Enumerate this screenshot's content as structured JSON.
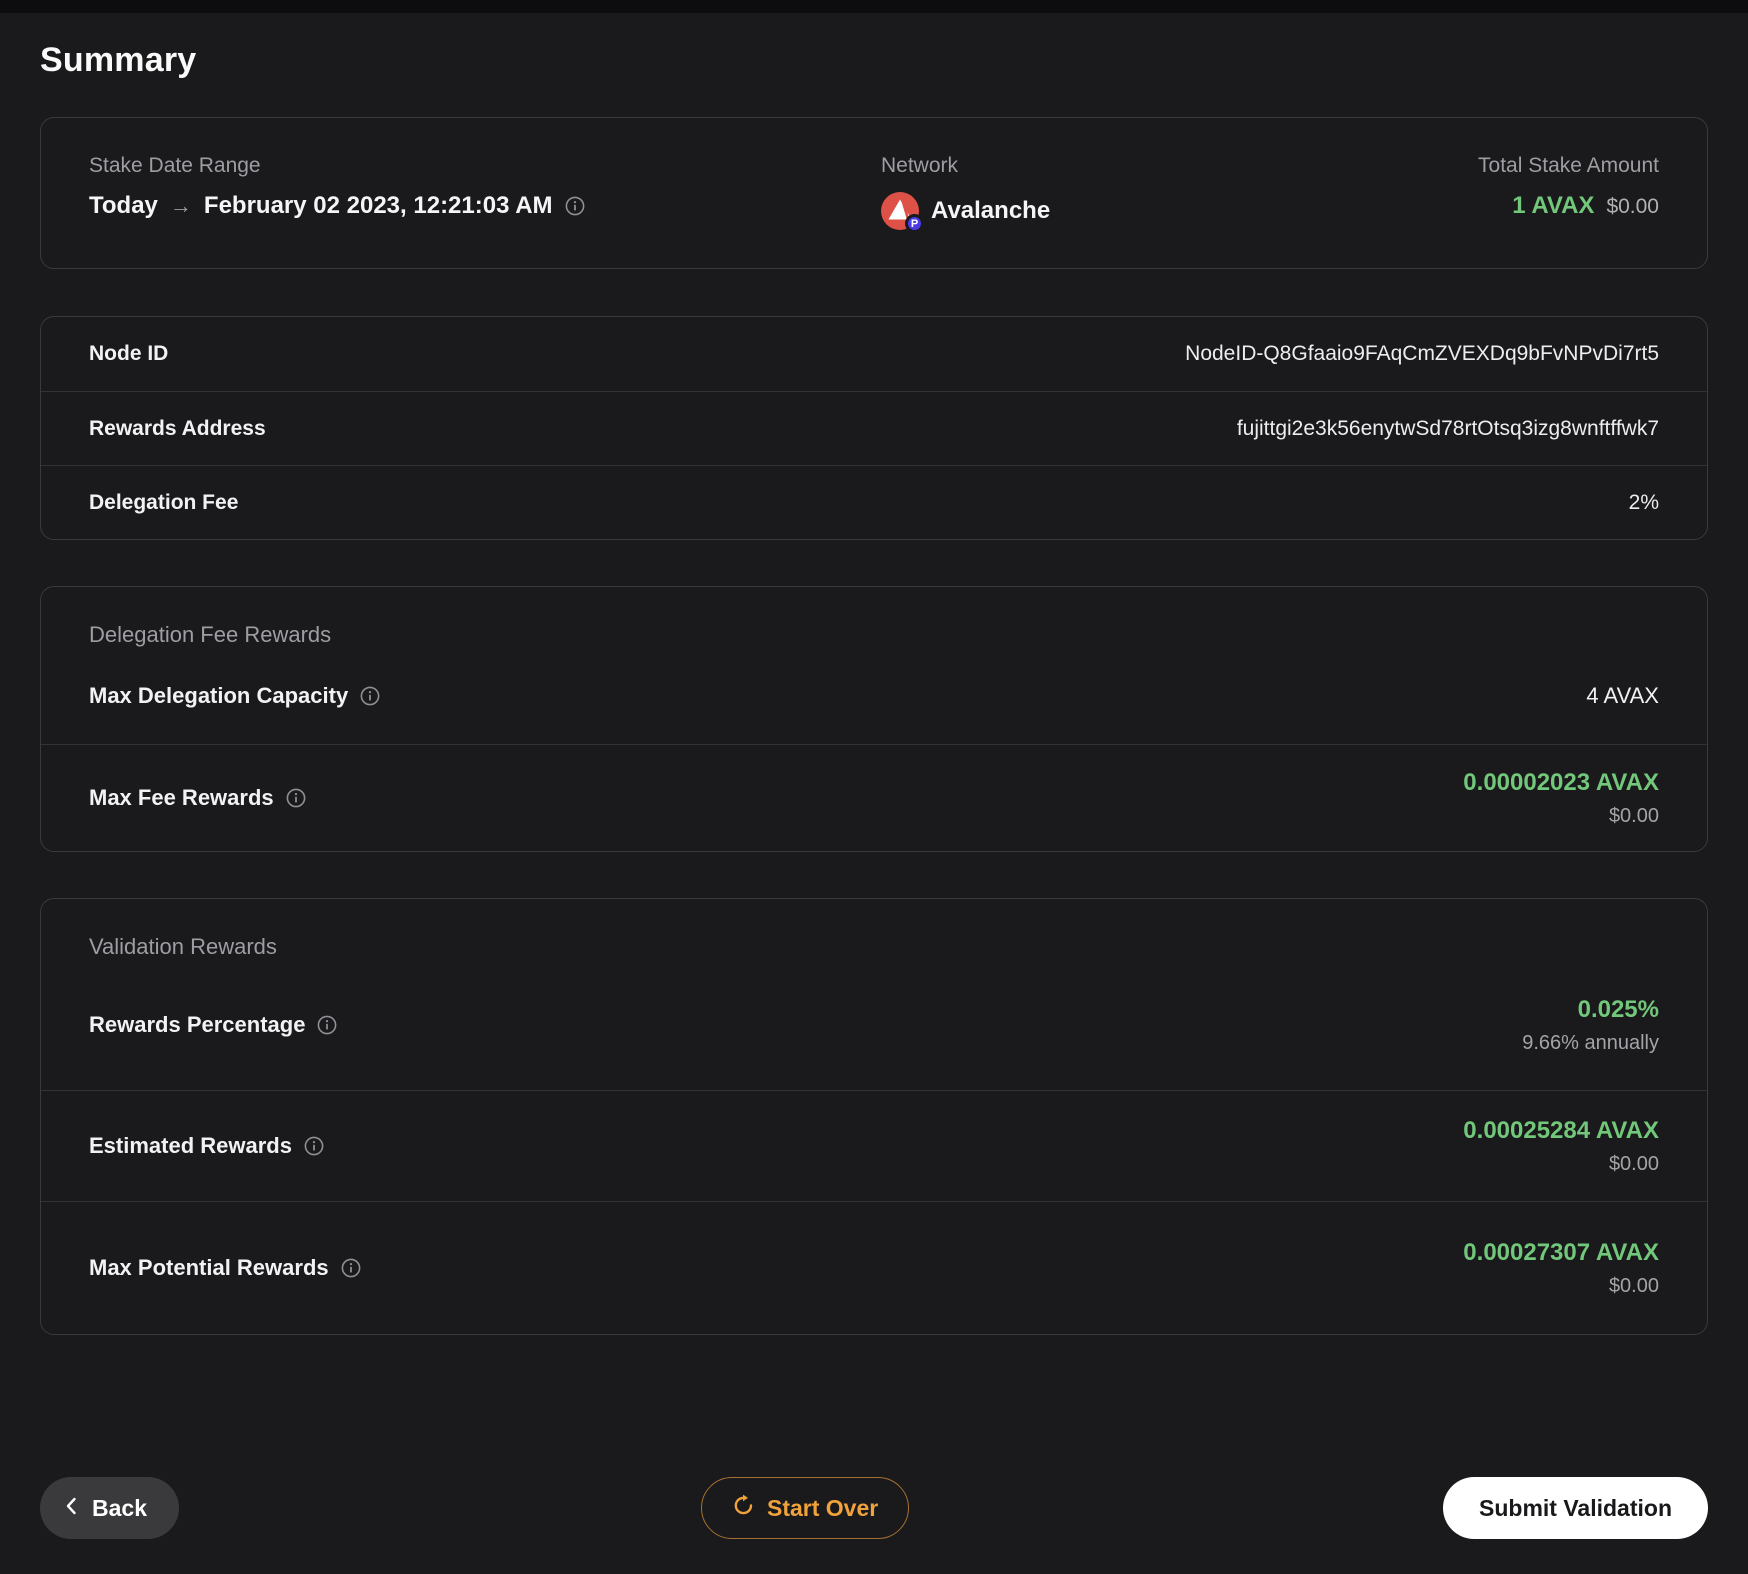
{
  "page": {
    "title": "Summary"
  },
  "overview": {
    "stake_date_range": {
      "label": "Stake Date Range",
      "from": "Today",
      "arrow": "→",
      "to": "February 02 2023, 12:21:03 AM"
    },
    "network": {
      "label": "Network",
      "name": "Avalanche",
      "badge": "P"
    },
    "total_stake": {
      "label": "Total Stake Amount",
      "amount": "1 AVAX",
      "usd": "$0.00"
    }
  },
  "details": {
    "rows": [
      {
        "label": "Node ID",
        "value": "NodeID-Q8Gfaaio9FAqCmZVEXDq9bFvNPvDi7rt5"
      },
      {
        "label": "Rewards Address",
        "value": "fujittgi2e3k56enytwSd78rtOtsq3izg8wnftffwk7"
      },
      {
        "label": "Delegation Fee",
        "value": "2%"
      }
    ]
  },
  "delegation_fee_rewards": {
    "title": "Delegation Fee Rewards",
    "rows": [
      {
        "label": "Max Delegation Capacity",
        "value": "4 AVAX"
      },
      {
        "label": "Max Fee Rewards",
        "value": "0.00002023 AVAX",
        "usd": "$0.00"
      }
    ]
  },
  "validation_rewards": {
    "title": "Validation Rewards",
    "rows": [
      {
        "label": "Rewards Percentage",
        "value": "0.025%",
        "sub": "9.66% annually"
      },
      {
        "label": "Estimated Rewards",
        "value": "0.00025284 AVAX",
        "sub": "$0.00"
      },
      {
        "label": "Max Potential Rewards",
        "value": "0.00027307 AVAX",
        "sub": "$0.00"
      }
    ]
  },
  "footer": {
    "back": "Back",
    "start_over": "Start Over",
    "submit": "Submit Validation"
  },
  "colors": {
    "accent_green": "#72c77a",
    "accent_orange": "#f0a23c",
    "avalanche_red": "#dd5147",
    "p_badge_purple": "#4b3be4"
  }
}
